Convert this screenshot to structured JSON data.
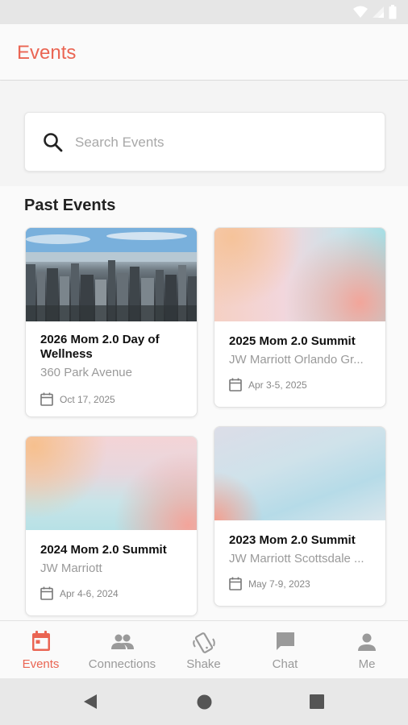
{
  "app": {
    "title": "Events"
  },
  "search": {
    "placeholder": "Search Events",
    "icon": "search-icon"
  },
  "section": {
    "past_events_title": "Past Events"
  },
  "events": [
    {
      "title": "2026 Mom 2.0 Day of Wellness",
      "location": "360 Park Avenue",
      "date": "Oct 17, 2025",
      "image": "city-skyline"
    },
    {
      "title": "2025 Mom 2.0 Summit",
      "location": "JW Marriott Orlando Gr...",
      "date": "Apr 3-5, 2025",
      "image": "gradient"
    },
    {
      "title": "2024 Mom 2.0 Summit",
      "location": "JW Marriott",
      "date": "Apr 4-6, 2024",
      "image": "gradient"
    },
    {
      "title": "2023 Mom 2.0 Summit",
      "location": "JW Marriott Scottsdale ...",
      "date": "May 7-9, 2023",
      "image": "gradient"
    }
  ],
  "bottom_nav": {
    "items": [
      {
        "label": "Events",
        "icon": "calendar-icon",
        "active": true
      },
      {
        "label": "Connections",
        "icon": "people-icon",
        "active": false
      },
      {
        "label": "Shake",
        "icon": "shake-phone-icon",
        "active": false
      },
      {
        "label": "Chat",
        "icon": "chat-icon",
        "active": false
      },
      {
        "label": "Me",
        "icon": "person-icon",
        "active": false
      }
    ]
  },
  "colors": {
    "accent": "#ea6553",
    "inactive": "#9a9a9a"
  }
}
